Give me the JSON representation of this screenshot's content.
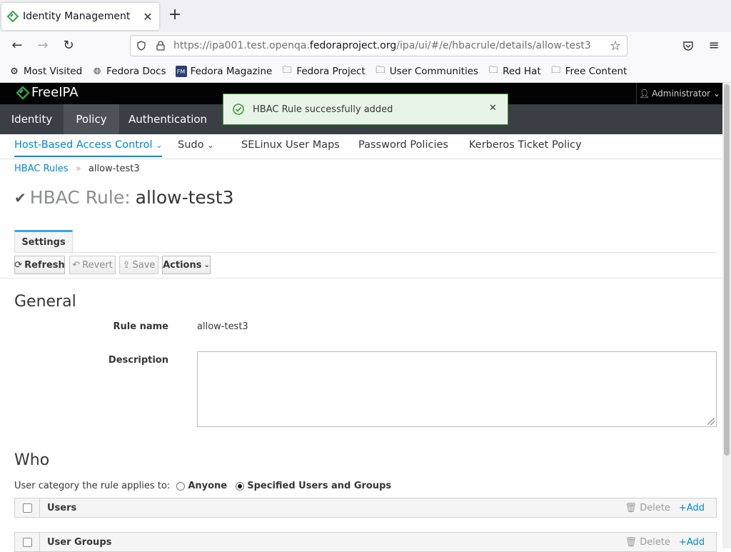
{
  "browser": {
    "tab_title": "Identity Management",
    "url_prefix": "https://ipa001.test.openqa.",
    "url_domain": "fedoraproject.org",
    "url_suffix": "/ipa/ui/#/e/hbacrule/details/allow-test3",
    "bookmarks": [
      {
        "label": "Most Visited",
        "icon": "gear-icon"
      },
      {
        "label": "Fedora Docs",
        "icon": "globe-icon"
      },
      {
        "label": "Fedora Magazine",
        "icon": "fedora-magazine-icon"
      },
      {
        "label": "Fedora Project",
        "icon": "folder-icon"
      },
      {
        "label": "User Communities",
        "icon": "folder-icon"
      },
      {
        "label": "Red Hat",
        "icon": "folder-icon"
      },
      {
        "label": "Free Content",
        "icon": "folder-icon"
      }
    ]
  },
  "app": {
    "logo": "FreeIPA",
    "user": "Administrator",
    "main_nav": [
      "Identity",
      "Policy",
      "Authentication"
    ],
    "sub_nav": [
      "Host-Based Access Control",
      "Sudo",
      "SELinux User Maps",
      "Password Policies",
      "Kerberos Ticket Policy"
    ],
    "toast": "HBAC Rule successfully added"
  },
  "page": {
    "breadcrumb_parent": "HBAC Rules",
    "breadcrumb_sep": "»",
    "breadcrumb_current": "allow-test3",
    "title_prefix": "HBAC Rule:",
    "title_name": "allow-test3",
    "tab_settings": "Settings",
    "buttons": {
      "refresh": "Refresh",
      "revert": "Revert",
      "save": "Save",
      "actions": "Actions"
    },
    "general": {
      "heading": "General",
      "rule_name_label": "Rule name",
      "rule_name_value": "allow-test3",
      "description_label": "Description"
    },
    "who": {
      "heading": "Who",
      "category_label": "User category the rule applies to:",
      "option_anyone": "Anyone",
      "option_specified": "Specified Users and Groups",
      "users_header": "Users",
      "groups_header": "User Groups",
      "delete_label": "Delete",
      "add_label": "Add"
    }
  },
  "colors": {
    "accent": "#0088ce",
    "nav_bg": "#393f44",
    "topbar_bg": "#030303",
    "toast_border": "#3f9c35"
  }
}
